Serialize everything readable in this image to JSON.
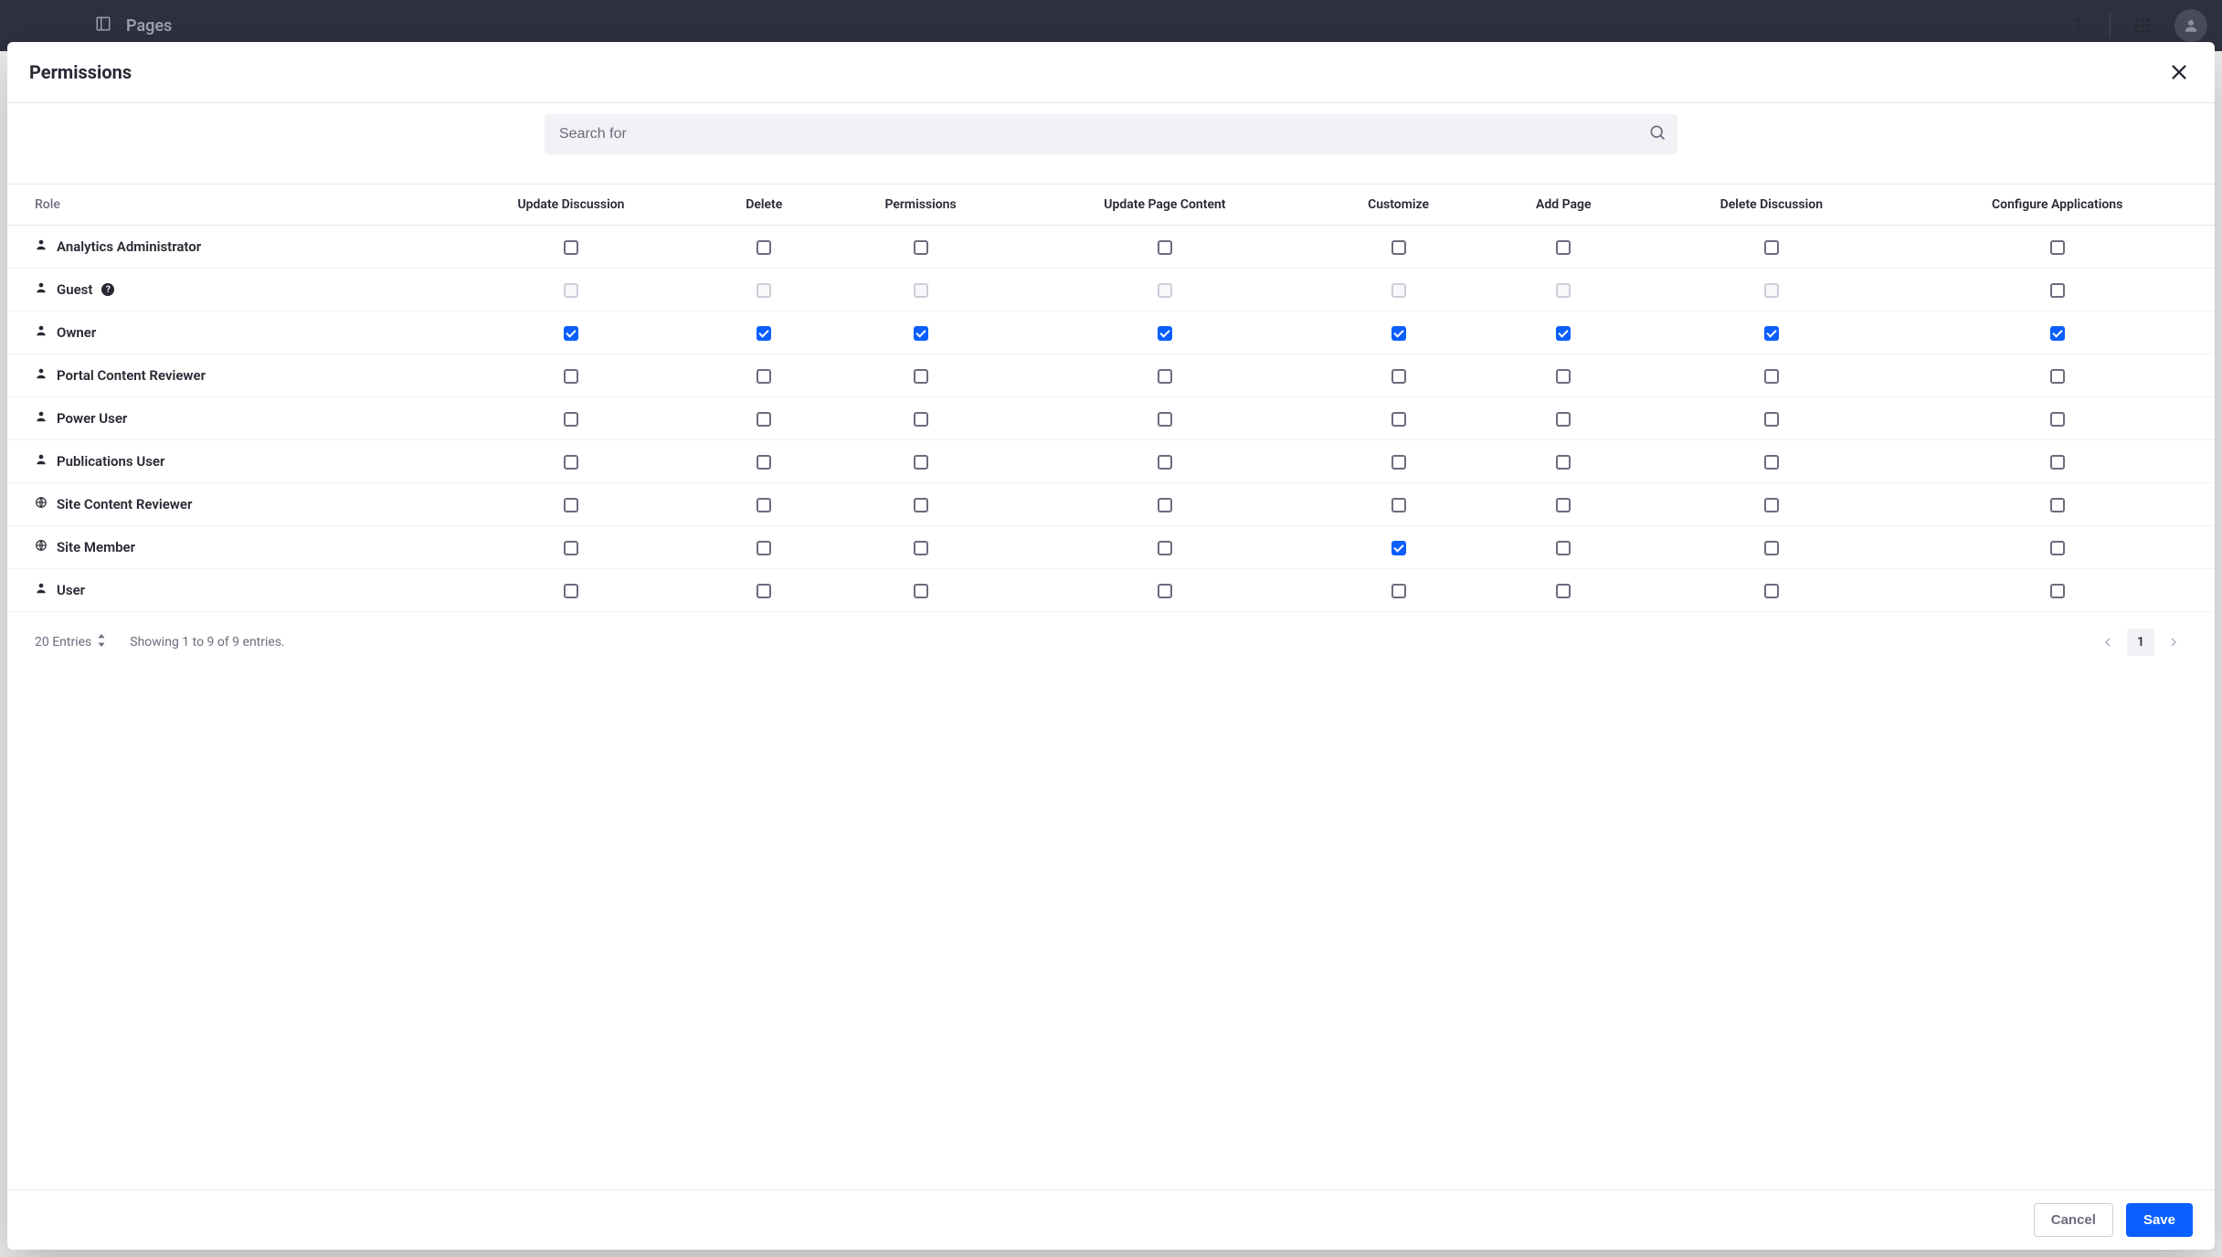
{
  "appbar": {
    "title": "Pages"
  },
  "modal": {
    "title": "Permissions",
    "search_placeholder": "Search for",
    "columns": {
      "role_header": "Role",
      "perms": [
        "Update Discussion",
        "Delete",
        "Permissions",
        "Update Page Content",
        "Customize",
        "Add Page",
        "Delete Discussion",
        "Configure Applications"
      ]
    },
    "roles": [
      {
        "name": "Analytics Administrator",
        "icon": "user",
        "info": false,
        "disabled": false,
        "checks": [
          false,
          false,
          false,
          false,
          false,
          false,
          false,
          false
        ]
      },
      {
        "name": "Guest",
        "icon": "user",
        "info": true,
        "disabled": true,
        "checks": [
          false,
          false,
          false,
          false,
          false,
          false,
          false,
          false
        ]
      },
      {
        "name": "Owner",
        "icon": "user",
        "info": false,
        "disabled": false,
        "checks": [
          true,
          true,
          true,
          true,
          true,
          true,
          true,
          true
        ]
      },
      {
        "name": "Portal Content Reviewer",
        "icon": "user",
        "info": false,
        "disabled": false,
        "checks": [
          false,
          false,
          false,
          false,
          false,
          false,
          false,
          false
        ]
      },
      {
        "name": "Power User",
        "icon": "user",
        "info": false,
        "disabled": false,
        "checks": [
          false,
          false,
          false,
          false,
          false,
          false,
          false,
          false
        ]
      },
      {
        "name": "Publications User",
        "icon": "user",
        "info": false,
        "disabled": false,
        "checks": [
          false,
          false,
          false,
          false,
          false,
          false,
          false,
          false
        ]
      },
      {
        "name": "Site Content Reviewer",
        "icon": "globe",
        "info": false,
        "disabled": false,
        "checks": [
          false,
          false,
          false,
          false,
          false,
          false,
          false,
          false
        ]
      },
      {
        "name": "Site Member",
        "icon": "globe",
        "info": false,
        "disabled": false,
        "checks": [
          false,
          false,
          false,
          false,
          true,
          false,
          false,
          false
        ]
      },
      {
        "name": "User",
        "icon": "user",
        "info": false,
        "disabled": false,
        "checks": [
          false,
          false,
          false,
          false,
          false,
          false,
          false,
          false
        ]
      }
    ],
    "footer": {
      "entries_label": "20 Entries",
      "showing_label": "Showing 1 to 9 of 9 entries.",
      "page": "1",
      "cancel": "Cancel",
      "save": "Save"
    }
  }
}
